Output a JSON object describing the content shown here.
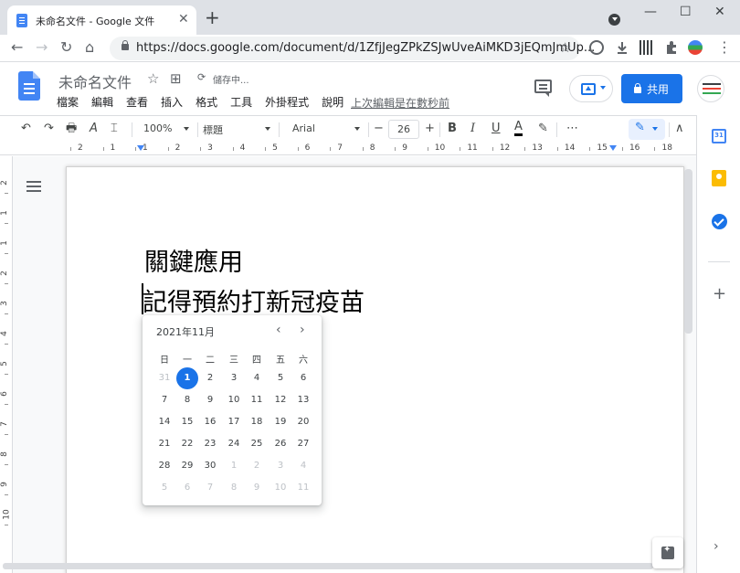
{
  "browser": {
    "tab_title": "未命名文件 - Google 文件",
    "tab_close": "✕",
    "new_tab": "+",
    "window_controls": {
      "minimize": "—",
      "maximize": "☐",
      "close": "✕"
    },
    "nav": {
      "back": "←",
      "forward": "→",
      "reload": "↻",
      "home": "⌂"
    },
    "url": "https://docs.google.com/document/d/1ZfjJegZPkZSJwUveAiMKD3jEQmJmUp...",
    "star": "☆"
  },
  "docs": {
    "title": "未命名文件",
    "saving_text": "儲存中...",
    "menu": [
      "檔案",
      "編輯",
      "查看",
      "插入",
      "格式",
      "工具",
      "外掛程式",
      "說明"
    ],
    "last_edit": "上次編輯是在數秒前",
    "share_label": "共用",
    "toolbar": {
      "undo": "↶",
      "redo": "↷",
      "print": "🖶",
      "spellcheck": "A",
      "paint_format": "⌶",
      "zoom": "100%",
      "style": "標題",
      "font": "Arial",
      "font_minus": "−",
      "font_size": "26",
      "font_plus": "+",
      "bold": "B",
      "italic": "I",
      "underline": "U",
      "text_color": "A",
      "highlight": "✎",
      "more": "⋯",
      "collapse": "∧"
    },
    "ruler_numbers": [
      "2",
      "1",
      "1",
      "2",
      "3",
      "4",
      "5",
      "6",
      "7",
      "8",
      "9",
      "10",
      "11",
      "12",
      "13",
      "14",
      "15",
      "16",
      "18"
    ],
    "vruler_numbers": [
      "2",
      "1",
      "1",
      "2",
      "3",
      "4",
      "5",
      "6",
      "7",
      "8",
      "9",
      "10"
    ],
    "content": {
      "line1": "關鍵應用",
      "line2": "記得預約打新冠疫苗"
    }
  },
  "date_picker": {
    "month_label": "2021年11月",
    "prev": "‹",
    "next": "›",
    "weekdays": [
      "日",
      "一",
      "二",
      "三",
      "四",
      "五",
      "六"
    ],
    "weeks": [
      [
        "31",
        "1",
        "2",
        "3",
        "4",
        "5",
        "6"
      ],
      [
        "7",
        "8",
        "9",
        "10",
        "11",
        "12",
        "13"
      ],
      [
        "14",
        "15",
        "16",
        "17",
        "18",
        "19",
        "20"
      ],
      [
        "21",
        "22",
        "23",
        "24",
        "25",
        "26",
        "27"
      ],
      [
        "28",
        "29",
        "30",
        "1",
        "2",
        "3",
        "4"
      ],
      [
        "5",
        "6",
        "7",
        "8",
        "9",
        "10",
        "11"
      ]
    ],
    "selected": "1"
  },
  "side_panel": {
    "calendar_day": "31",
    "add": "+",
    "expand": "›"
  },
  "colors": {
    "accent": "#1a73e8",
    "docs_blue": "#4285f4",
    "keep_yellow": "#fbbc04"
  }
}
